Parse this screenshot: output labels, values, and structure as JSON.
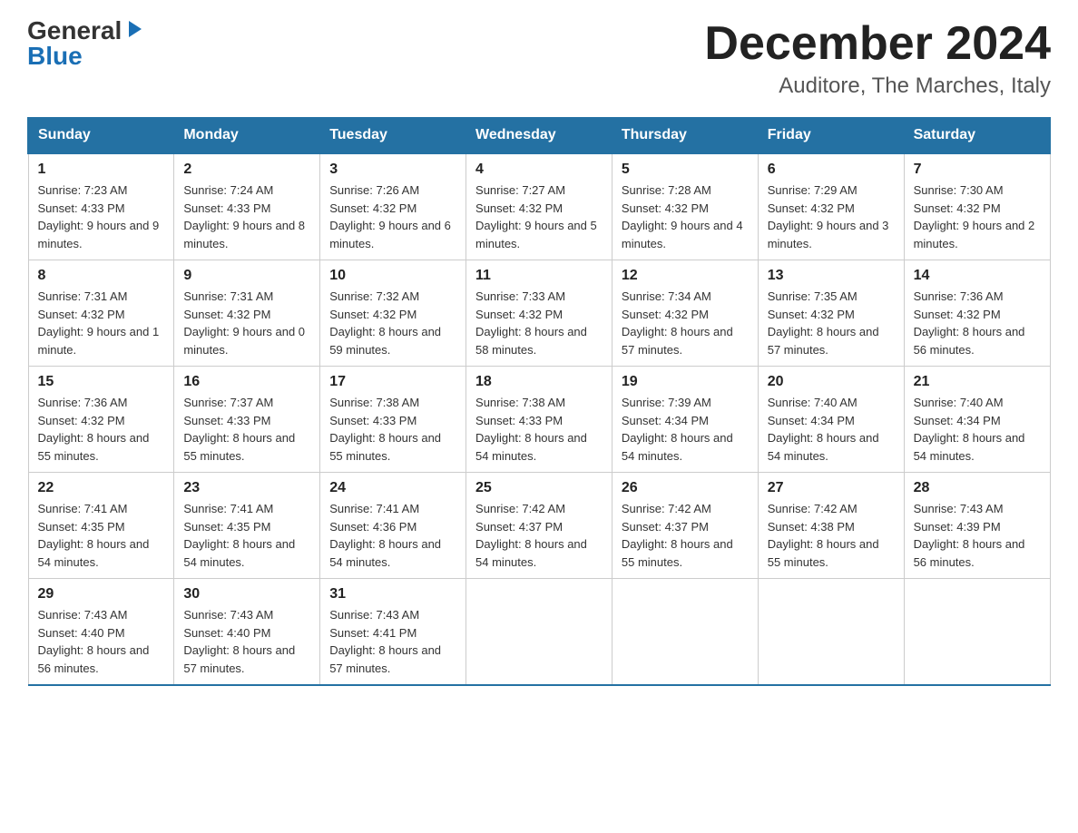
{
  "header": {
    "logo_general": "General",
    "logo_blue": "Blue",
    "month_title": "December 2024",
    "subtitle": "Auditore, The Marches, Italy"
  },
  "days_of_week": [
    "Sunday",
    "Monday",
    "Tuesday",
    "Wednesday",
    "Thursday",
    "Friday",
    "Saturday"
  ],
  "weeks": [
    [
      {
        "day": "1",
        "sunrise": "7:23 AM",
        "sunset": "4:33 PM",
        "daylight": "9 hours and 9 minutes."
      },
      {
        "day": "2",
        "sunrise": "7:24 AM",
        "sunset": "4:33 PM",
        "daylight": "9 hours and 8 minutes."
      },
      {
        "day": "3",
        "sunrise": "7:26 AM",
        "sunset": "4:32 PM",
        "daylight": "9 hours and 6 minutes."
      },
      {
        "day": "4",
        "sunrise": "7:27 AM",
        "sunset": "4:32 PM",
        "daylight": "9 hours and 5 minutes."
      },
      {
        "day": "5",
        "sunrise": "7:28 AM",
        "sunset": "4:32 PM",
        "daylight": "9 hours and 4 minutes."
      },
      {
        "day": "6",
        "sunrise": "7:29 AM",
        "sunset": "4:32 PM",
        "daylight": "9 hours and 3 minutes."
      },
      {
        "day": "7",
        "sunrise": "7:30 AM",
        "sunset": "4:32 PM",
        "daylight": "9 hours and 2 minutes."
      }
    ],
    [
      {
        "day": "8",
        "sunrise": "7:31 AM",
        "sunset": "4:32 PM",
        "daylight": "9 hours and 1 minute."
      },
      {
        "day": "9",
        "sunrise": "7:31 AM",
        "sunset": "4:32 PM",
        "daylight": "9 hours and 0 minutes."
      },
      {
        "day": "10",
        "sunrise": "7:32 AM",
        "sunset": "4:32 PM",
        "daylight": "8 hours and 59 minutes."
      },
      {
        "day": "11",
        "sunrise": "7:33 AM",
        "sunset": "4:32 PM",
        "daylight": "8 hours and 58 minutes."
      },
      {
        "day": "12",
        "sunrise": "7:34 AM",
        "sunset": "4:32 PM",
        "daylight": "8 hours and 57 minutes."
      },
      {
        "day": "13",
        "sunrise": "7:35 AM",
        "sunset": "4:32 PM",
        "daylight": "8 hours and 57 minutes."
      },
      {
        "day": "14",
        "sunrise": "7:36 AM",
        "sunset": "4:32 PM",
        "daylight": "8 hours and 56 minutes."
      }
    ],
    [
      {
        "day": "15",
        "sunrise": "7:36 AM",
        "sunset": "4:32 PM",
        "daylight": "8 hours and 55 minutes."
      },
      {
        "day": "16",
        "sunrise": "7:37 AM",
        "sunset": "4:33 PM",
        "daylight": "8 hours and 55 minutes."
      },
      {
        "day": "17",
        "sunrise": "7:38 AM",
        "sunset": "4:33 PM",
        "daylight": "8 hours and 55 minutes."
      },
      {
        "day": "18",
        "sunrise": "7:38 AM",
        "sunset": "4:33 PM",
        "daylight": "8 hours and 54 minutes."
      },
      {
        "day": "19",
        "sunrise": "7:39 AM",
        "sunset": "4:34 PM",
        "daylight": "8 hours and 54 minutes."
      },
      {
        "day": "20",
        "sunrise": "7:40 AM",
        "sunset": "4:34 PM",
        "daylight": "8 hours and 54 minutes."
      },
      {
        "day": "21",
        "sunrise": "7:40 AM",
        "sunset": "4:34 PM",
        "daylight": "8 hours and 54 minutes."
      }
    ],
    [
      {
        "day": "22",
        "sunrise": "7:41 AM",
        "sunset": "4:35 PM",
        "daylight": "8 hours and 54 minutes."
      },
      {
        "day": "23",
        "sunrise": "7:41 AM",
        "sunset": "4:35 PM",
        "daylight": "8 hours and 54 minutes."
      },
      {
        "day": "24",
        "sunrise": "7:41 AM",
        "sunset": "4:36 PM",
        "daylight": "8 hours and 54 minutes."
      },
      {
        "day": "25",
        "sunrise": "7:42 AM",
        "sunset": "4:37 PM",
        "daylight": "8 hours and 54 minutes."
      },
      {
        "day": "26",
        "sunrise": "7:42 AM",
        "sunset": "4:37 PM",
        "daylight": "8 hours and 55 minutes."
      },
      {
        "day": "27",
        "sunrise": "7:42 AM",
        "sunset": "4:38 PM",
        "daylight": "8 hours and 55 minutes."
      },
      {
        "day": "28",
        "sunrise": "7:43 AM",
        "sunset": "4:39 PM",
        "daylight": "8 hours and 56 minutes."
      }
    ],
    [
      {
        "day": "29",
        "sunrise": "7:43 AM",
        "sunset": "4:40 PM",
        "daylight": "8 hours and 56 minutes."
      },
      {
        "day": "30",
        "sunrise": "7:43 AM",
        "sunset": "4:40 PM",
        "daylight": "8 hours and 57 minutes."
      },
      {
        "day": "31",
        "sunrise": "7:43 AM",
        "sunset": "4:41 PM",
        "daylight": "8 hours and 57 minutes."
      },
      null,
      null,
      null,
      null
    ]
  ]
}
